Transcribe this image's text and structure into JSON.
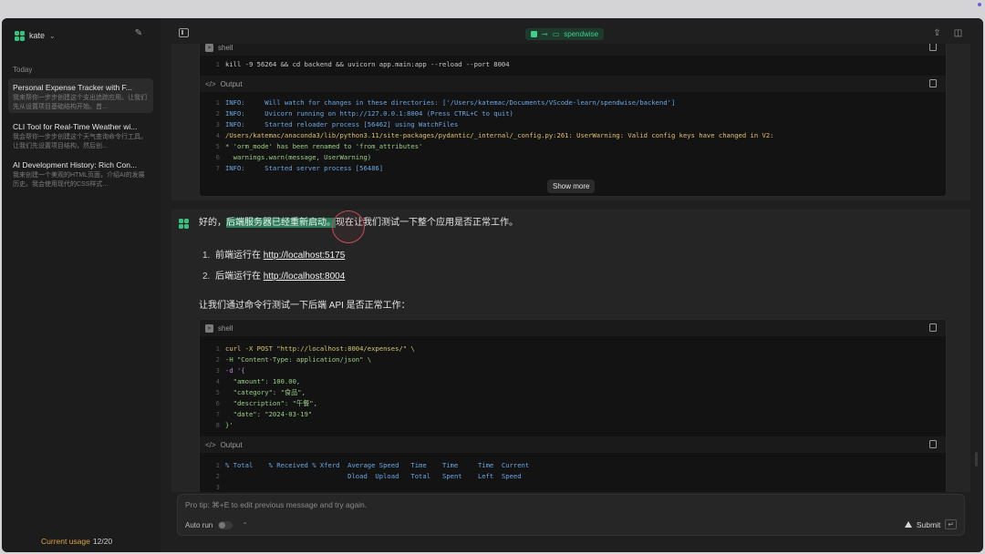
{
  "sidebar": {
    "user_name": "kate",
    "section_label": "Today",
    "chats": [
      {
        "title": "Personal Expense Tracker with F...",
        "preview": "我来帮你一步步创建这个支出追踪应用。让我们先从设置项目基础结构开始。首..."
      },
      {
        "title": "CLI Tool for Real-Time Weather wi...",
        "preview": "我会帮你一步步创建这个天气查询命令行工具。让我们先设置项目结构，然后创..."
      },
      {
        "title": "AI Development History: Rich Con...",
        "preview": "我来创建一个美观的HTML页面，介绍AI的发展历史。我会使用现代的CSS样式..."
      }
    ],
    "usage_label": "Current usage",
    "usage_value": "12/20"
  },
  "topbar": {
    "project_name": "spendwise"
  },
  "prev_message": {
    "shell_block": {
      "label": "shell",
      "command": "kill -9 56264 && cd backend && uvicorn app.main:app --reload --port 8004"
    },
    "output_block": {
      "label": "Output",
      "lines": [
        "INFO:     Will watch for changes in these directories: ['/Users/katemac/Documents/VScode-learn/spendwise/backend']",
        "INFO:     Uvicorn running on http://127.0.0.1:8004 (Press CTRL+C to quit)",
        "INFO:     Started reloader process [56462] using WatchFiles",
        "/Users/katemac/anaconda3/lib/python3.11/site-packages/pydantic/_internal/_config.py:261: UserWarning: Valid config keys have changed in V2:",
        "* 'orm_mode' has been renamed to 'from_attributes'",
        "  warnings.warn(message, UserWarning)",
        "INFO:     Started server process [56486]"
      ],
      "show_more": "Show more"
    }
  },
  "current_message": {
    "intro_prefix": "好的，",
    "intro_highlight": "后端服务器已经重新启动。",
    "intro_suffix": "现在让我们测试一下整个应用是否正常工作。",
    "list": [
      {
        "num": "1.",
        "text": "前端运行在 ",
        "link": "http://localhost:5175"
      },
      {
        "num": "2.",
        "text": "后端运行在 ",
        "link": "http://localhost:8004"
      }
    ],
    "paragraph": "让我们通过命令行测试一下后端 API 是否正常工作：",
    "shell_block": {
      "label": "shell",
      "lines": [
        "curl -X POST \"http://localhost:8004/expenses/\" \\",
        "-H \"Content-Type: application/json\" \\",
        "-d '{",
        "  \"amount\": 100.00,",
        "  \"category\": \"食品\",",
        "  \"description\": \"午餐\",",
        "  \"date\": \"2024-03-19\"",
        "}'"
      ]
    },
    "output_block": {
      "label": "Output",
      "lines": [
        "% Total    % Received % Xferd  Average Speed   Time    Time     Time  Current",
        "                               Dload  Upload   Total   Spent    Left  Speed",
        ""
      ]
    }
  },
  "composer": {
    "placeholder": "Pro tip: ⌘+E to edit previous message and try again.",
    "autorun_label": "Auto run",
    "submit_label": "Submit",
    "submit_key": "↵"
  },
  "colors": {
    "accent": "#35c27d",
    "highlight": "#2c7a57",
    "usage": "#d9a441"
  }
}
